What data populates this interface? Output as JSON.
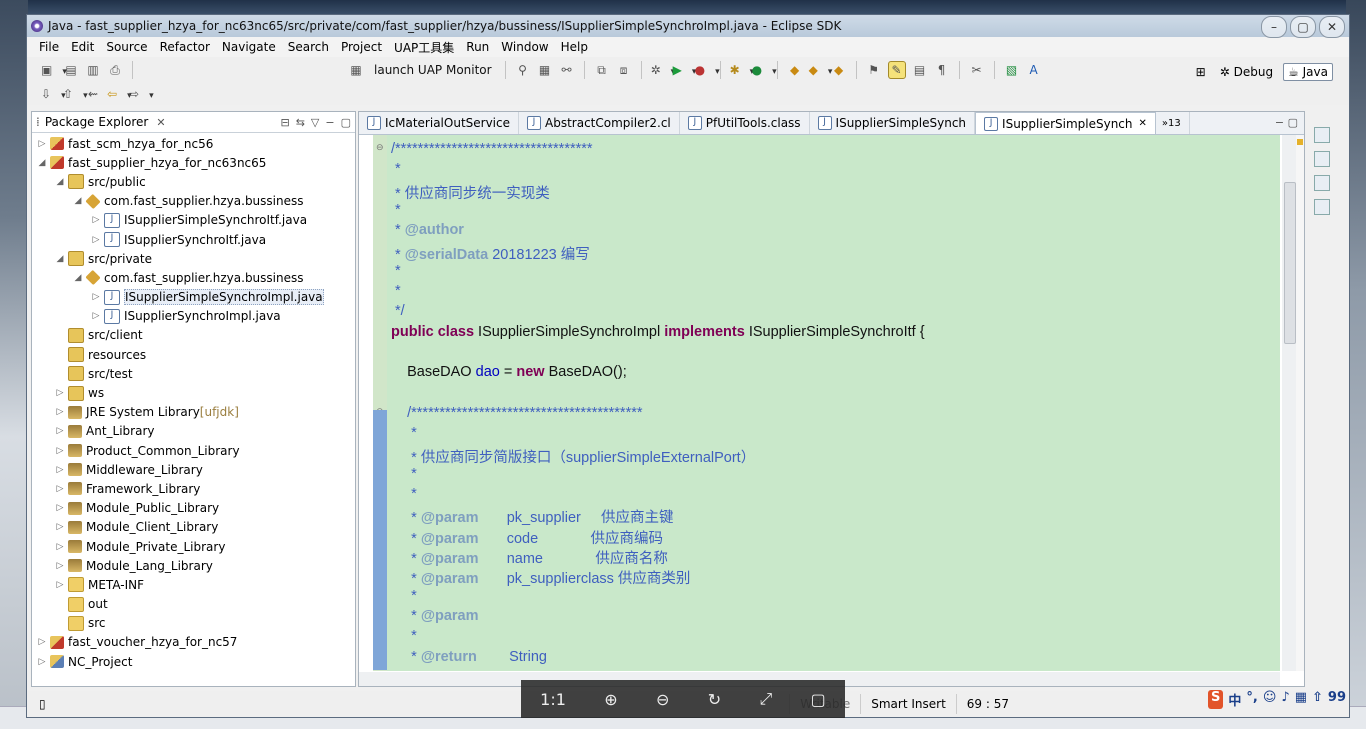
{
  "window": {
    "title": "Java - fast_supplier_hzya_for_nc63nc65/src/private/com/fast_supplier/hzya/bussiness/ISupplierSimpleSynchroImpl.java - Eclipse SDK"
  },
  "menu": [
    "File",
    "Edit",
    "Source",
    "Refactor",
    "Navigate",
    "Search",
    "Project",
    "UAP工具集",
    "Run",
    "Window",
    "Help"
  ],
  "toolbar": {
    "launch_label": "launch UAP Monitor"
  },
  "perspectives": {
    "debug": "Debug",
    "java": "Java"
  },
  "package_explorer": {
    "title": "Package Explorer",
    "items": [
      {
        "text": "fast_scm_hzya_for_nc56",
        "indent": 0,
        "icon": "project-icon",
        "tw": "▷"
      },
      {
        "text": "fast_supplier_hzya_for_nc63nc65",
        "indent": 0,
        "icon": "project-icon",
        "tw": "◢"
      },
      {
        "text": "src/public",
        "indent": 1,
        "icon": "source-folder-icon",
        "tw": "◢"
      },
      {
        "text": "com.fast_supplier.hzya.bussiness",
        "indent": 2,
        "icon": "package-icon",
        "tw": "◢"
      },
      {
        "text": "ISupplierSimpleSynchroItf.java",
        "indent": 3,
        "icon": "java-file-icon",
        "tw": "▷"
      },
      {
        "text": "ISupplierSynchroItf.java",
        "indent": 3,
        "icon": "java-file-icon",
        "tw": "▷"
      },
      {
        "text": "src/private",
        "indent": 1,
        "icon": "source-folder-icon",
        "tw": "◢"
      },
      {
        "text": "com.fast_supplier.hzya.bussiness",
        "indent": 2,
        "icon": "package-icon",
        "tw": "◢"
      },
      {
        "text": "ISupplierSimpleSynchroImpl.java",
        "indent": 3,
        "icon": "java-file-icon",
        "tw": "▷",
        "selected": true
      },
      {
        "text": "ISupplierSynchroImpl.java",
        "indent": 3,
        "icon": "java-file-icon",
        "tw": "▷"
      },
      {
        "text": "src/client",
        "indent": 1,
        "icon": "source-folder-icon",
        "tw": ""
      },
      {
        "text": "resources",
        "indent": 1,
        "icon": "source-folder-icon",
        "tw": ""
      },
      {
        "text": "src/test",
        "indent": 1,
        "icon": "source-folder-icon",
        "tw": ""
      },
      {
        "text": "ws",
        "indent": 1,
        "icon": "source-folder-icon",
        "tw": "▷"
      },
      {
        "text": "JRE System Library",
        "suffix": "[ufjdk]",
        "indent": 1,
        "icon": "library-icon",
        "tw": "▷"
      },
      {
        "text": "Ant_Library",
        "indent": 1,
        "icon": "library-icon",
        "tw": "▷"
      },
      {
        "text": "Product_Common_Library",
        "indent": 1,
        "icon": "library-icon",
        "tw": "▷"
      },
      {
        "text": "Middleware_Library",
        "indent": 1,
        "icon": "library-icon",
        "tw": "▷"
      },
      {
        "text": "Framework_Library",
        "indent": 1,
        "icon": "library-icon",
        "tw": "▷"
      },
      {
        "text": "Module_Public_Library",
        "indent": 1,
        "icon": "library-icon",
        "tw": "▷"
      },
      {
        "text": "Module_Client_Library",
        "indent": 1,
        "icon": "library-icon",
        "tw": "▷"
      },
      {
        "text": "Module_Private_Library",
        "indent": 1,
        "icon": "library-icon",
        "tw": "▷"
      },
      {
        "text": "Module_Lang_Library",
        "indent": 1,
        "icon": "library-icon",
        "tw": "▷"
      },
      {
        "text": "META-INF",
        "indent": 1,
        "icon": "folder-icon",
        "tw": "▷"
      },
      {
        "text": "out",
        "indent": 1,
        "icon": "folder-icon",
        "tw": ""
      },
      {
        "text": "src",
        "indent": 1,
        "icon": "folder-icon",
        "tw": ""
      },
      {
        "text": "fast_voucher_hzya_for_nc57",
        "indent": 0,
        "icon": "project-icon",
        "tw": "▷"
      },
      {
        "text": "NC_Project",
        "indent": 0,
        "icon": "project2-icon",
        "tw": "▷"
      }
    ]
  },
  "editor_tabs": [
    {
      "label": "IcMaterialOutService",
      "active": false
    },
    {
      "label": "AbstractCompiler2.cl",
      "active": false
    },
    {
      "label": "PfUtilTools.class",
      "active": false
    },
    {
      "label": "ISupplierSimpleSynch",
      "active": false
    },
    {
      "label": "ISupplierSimpleSynch",
      "active": true
    }
  ],
  "editor_overflow": "»13",
  "code_lines": [
    [
      [
        "cm",
        "/***********************************"
      ]
    ],
    [
      [
        "cm",
        " *"
      ]
    ],
    [
      [
        "cm",
        " * 供应商同步统一实现类"
      ]
    ],
    [
      [
        "cm",
        " *"
      ]
    ],
    [
      [
        "cm",
        " * "
      ],
      [
        "tag",
        "@author"
      ]
    ],
    [
      [
        "cm",
        " * "
      ],
      [
        "tag",
        "@serialData"
      ],
      [
        "cm",
        " 20181223 编写"
      ]
    ],
    [
      [
        "cm",
        " *"
      ]
    ],
    [
      [
        "cm",
        " *"
      ]
    ],
    [
      [
        "cm",
        " */"
      ]
    ],
    [
      [
        "kw",
        "public class"
      ],
      [
        "",
        " ISupplierSimpleSynchroImpl "
      ],
      [
        "kw",
        "implements"
      ],
      [
        "",
        " ISupplierSimpleSynchroItf {"
      ]
    ],
    [
      [
        "",
        ""
      ]
    ],
    [
      [
        "",
        "    BaseDAO "
      ],
      [
        "fld",
        "dao"
      ],
      [
        "",
        " = "
      ],
      [
        "kw",
        "new"
      ],
      [
        "",
        " BaseDAO();"
      ]
    ],
    [
      [
        "",
        ""
      ]
    ],
    [
      [
        "cm",
        "    /*****************************************"
      ]
    ],
    [
      [
        "cm",
        "     *"
      ]
    ],
    [
      [
        "cm",
        "     * 供应商同步简版接口（supplierSimpleExternalPort）"
      ]
    ],
    [
      [
        "cm",
        "     *"
      ]
    ],
    [
      [
        "cm",
        "     *"
      ]
    ],
    [
      [
        "cm",
        "     * "
      ],
      [
        "tag",
        "@param"
      ],
      [
        "cm",
        "       pk_supplier     供应商主键"
      ]
    ],
    [
      [
        "cm",
        "     * "
      ],
      [
        "tag",
        "@param"
      ],
      [
        "cm",
        "       code             供应商编码"
      ]
    ],
    [
      [
        "cm",
        "     * "
      ],
      [
        "tag",
        "@param"
      ],
      [
        "cm",
        "       name             供应商名称"
      ]
    ],
    [
      [
        "cm",
        "     * "
      ],
      [
        "tag",
        "@param"
      ],
      [
        "cm",
        "       pk_supplierclass 供应商类别"
      ]
    ],
    [
      [
        "cm",
        "     *"
      ]
    ],
    [
      [
        "cm",
        "     * "
      ],
      [
        "tag",
        "@param"
      ]
    ],
    [
      [
        "cm",
        "     *"
      ]
    ],
    [
      [
        "cm",
        "     * "
      ],
      [
        "tag",
        "@return"
      ],
      [
        "cm",
        "        String"
      ]
    ]
  ],
  "status": {
    "mode": "Smart Insert",
    "position": "69 : 57",
    "writable": "Writable"
  },
  "viewer": [
    "1:1",
    "⊕",
    "⊖",
    "↻",
    "⤢",
    "▢"
  ],
  "tray": [
    "中",
    "°,",
    "☺",
    "♪",
    "▦",
    "⇧",
    "99"
  ]
}
